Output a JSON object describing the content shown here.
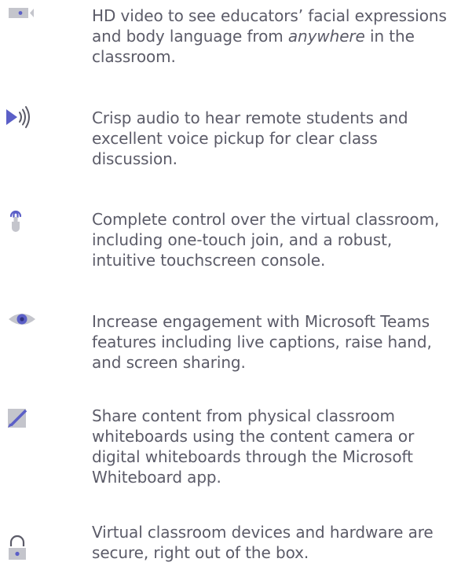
{
  "colors": {
    "icon_gray": "#c4c5cc",
    "icon_blue": "#5b5fc7",
    "text": "#5b5b68"
  },
  "features": [
    {
      "icon": "video-camera-icon",
      "text_before": "HD video to see educators’ facial expressions and body language from ",
      "text_emphasis": "anywhere",
      "text_after": " in the classroom."
    },
    {
      "icon": "speaker-audio-icon",
      "text": "Crisp audio to hear remote students and excellent voice pickup for clear class discussion."
    },
    {
      "icon": "touch-finger-icon",
      "text": "Complete control over the virtual classroom, including one-touch join, and a robust, intuitive touchscreen console."
    },
    {
      "icon": "eye-icon",
      "text": "Increase engagement with Microsoft Teams features including live captions, raise hand, and screen sharing."
    },
    {
      "icon": "pen-icon",
      "text": "Share content from physical classroom whiteboards using the content camera or digital whiteboards through the Microsoft Whiteboard app."
    },
    {
      "icon": "padlock-icon",
      "text": "Virtual classroom devices and hardware are secure, right out of the box."
    }
  ]
}
